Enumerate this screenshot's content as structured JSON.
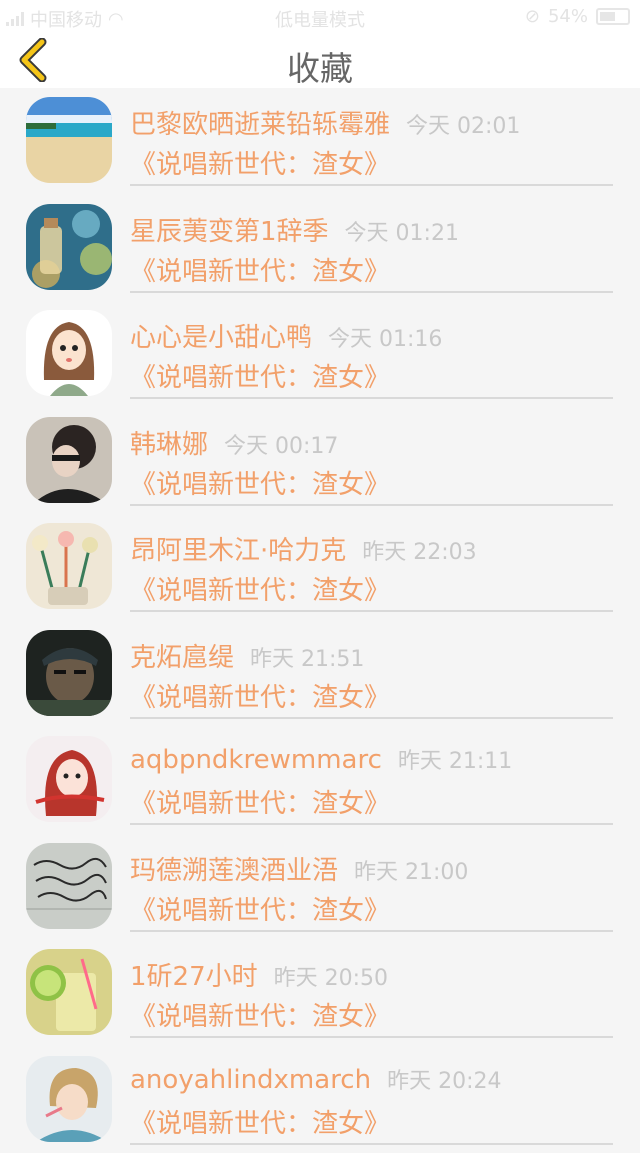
{
  "status_bar": {
    "carrier": "中国移动",
    "mode": "低电量模式",
    "battery_text": "54%"
  },
  "nav": {
    "title": "收藏",
    "accent_color": "#f5c518"
  },
  "items": [
    {
      "name": "巴黎欧晒逝莱铅轹霉雅",
      "time": "今天 02:01",
      "title": "《说唱新世代：渣女》",
      "avatar_icon": "beach-photo"
    },
    {
      "name": "星辰荑变第1辞季",
      "time": "今天 01:21",
      "title": "《说唱新世代：渣女》",
      "avatar_icon": "bottle-bokeh-photo"
    },
    {
      "name": "心心是小甜心鸭",
      "time": "今天 01:16",
      "title": "《说唱新世代：渣女》",
      "avatar_icon": "cartoon-girl"
    },
    {
      "name": "韩琳娜",
      "time": "今天 00:17",
      "title": "《说唱新世代：渣女》",
      "avatar_icon": "person-photo"
    },
    {
      "name": "昂阿里木江·哈力克",
      "time": "昨天 22:03",
      "title": "《说唱新世代：渣女》",
      "avatar_icon": "flower-pens-photo"
    },
    {
      "name": "克炻扈缇",
      "time": "昨天 21:51",
      "title": "《说唱新世代：渣女》",
      "avatar_icon": "game-character-photo"
    },
    {
      "name": "aqbpndkrewmmarc",
      "time": "昨天 21:11",
      "title": "《说唱新世代：渣女》",
      "avatar_icon": "redhair-girl-photo"
    },
    {
      "name": "玛德溯莲澳酒业浯",
      "time": "昨天 21:00",
      "title": "《说唱新世代：渣女》",
      "avatar_icon": "handwriting-photo"
    },
    {
      "name": "1斫27小时",
      "time": "昨天 20:50",
      "title": "《说唱新世代：渣女》",
      "avatar_icon": "lime-drink-photo"
    },
    {
      "name": "anoyahlindxmarch",
      "time": "昨天 20:24",
      "title": "《说唱新世代：渣女》",
      "avatar_icon": "child-photo"
    }
  ]
}
